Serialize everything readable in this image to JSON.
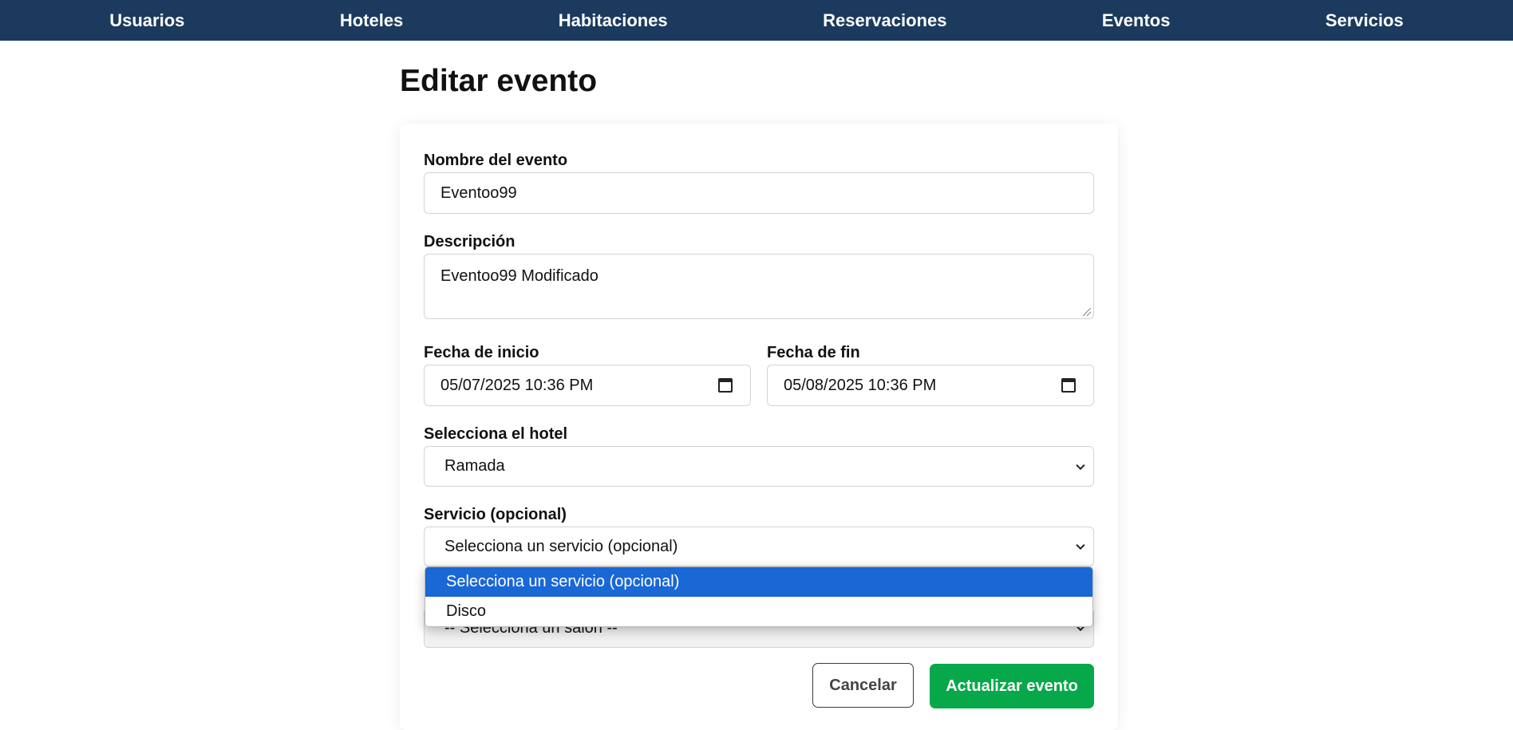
{
  "nav": {
    "items": [
      {
        "label": "Usuarios"
      },
      {
        "label": "Hoteles"
      },
      {
        "label": "Habitaciones"
      },
      {
        "label": "Reservaciones"
      },
      {
        "label": "Eventos"
      },
      {
        "label": "Servicios"
      }
    ],
    "background_color": "#1b3a5e"
  },
  "page": {
    "title": "Editar evento"
  },
  "form": {
    "nombre": {
      "label": "Nombre del evento",
      "value": "Eventoo99"
    },
    "descripcion": {
      "label": "Descripción",
      "value": "Eventoo99 Modificado"
    },
    "fecha_inicio": {
      "label": "Fecha de inicio",
      "value": "05/07/2025 10:36 PM",
      "icon": "calendar-icon"
    },
    "fecha_fin": {
      "label": "Fecha de fin",
      "value": "05/08/2025 10:36 PM",
      "icon": "calendar-icon"
    },
    "hotel": {
      "label": "Selecciona el hotel",
      "selected": "Ramada",
      "icon": "chevron-down-icon"
    },
    "servicio": {
      "label": "Servicio (opcional)",
      "selected": "Selecciona un servicio (opcional)",
      "icon": "chevron-down-icon",
      "options": [
        {
          "label": "Selecciona un servicio (opcional)",
          "highlighted": true
        },
        {
          "label": "Disco",
          "highlighted": false
        }
      ],
      "dropdown_open": true
    },
    "salon": {
      "selected": "-- Selecciona un salón --",
      "icon": "chevron-down-icon"
    }
  },
  "buttons": {
    "cancel_label": "Cancelar",
    "submit_label": "Actualizar evento",
    "submit_color": "#06a84a",
    "highlight_color": "#1a67d6"
  }
}
